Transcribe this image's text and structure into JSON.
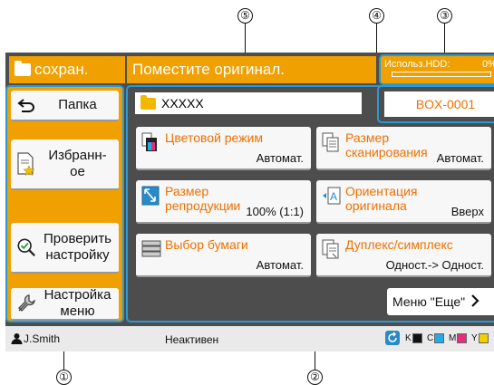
{
  "callouts": [
    "①",
    "②",
    "③",
    "④",
    "⑤"
  ],
  "header": {
    "mode_label": "сохран.",
    "message": "Поместите оригинал.",
    "hdd_label": "Использ.HDD:",
    "hdd_value": "0%"
  },
  "left_buttons": [
    {
      "label": "Папка"
    },
    {
      "label": "Избранн-\nое"
    },
    {
      "label": "Проверить\nнастройку"
    },
    {
      "label": "Настройка\nменю"
    }
  ],
  "path_value": "XXXXX",
  "box_label": "BOX-0001",
  "tiles": [
    {
      "title": "Цветовой режим",
      "value": "Автомат."
    },
    {
      "title": "Размер\nсканирования",
      "value": "Автомат."
    },
    {
      "title": "Размер\nрепродукции",
      "value": "100% (1:1)"
    },
    {
      "title": "Ориентация\nоригинала",
      "value": "Вверх"
    },
    {
      "title": "Выбор бумаги",
      "value": "Автомат."
    },
    {
      "title": "Дуплекс/симплекс",
      "value": "Одност.-> Одност."
    }
  ],
  "more_label": "Меню \"Еще\"",
  "status": {
    "user": "J.Smith",
    "state": "Неактивен",
    "inks": [
      {
        "label": "K",
        "color": "#111111"
      },
      {
        "label": "C",
        "color": "#2aa8e0"
      },
      {
        "label": "M",
        "color": "#e0307a"
      },
      {
        "label": "Y",
        "color": "#f2d000"
      }
    ]
  },
  "colors": {
    "accent": "#f0a000",
    "highlight": "#2a9ad6",
    "tile_text": "#f07000"
  }
}
